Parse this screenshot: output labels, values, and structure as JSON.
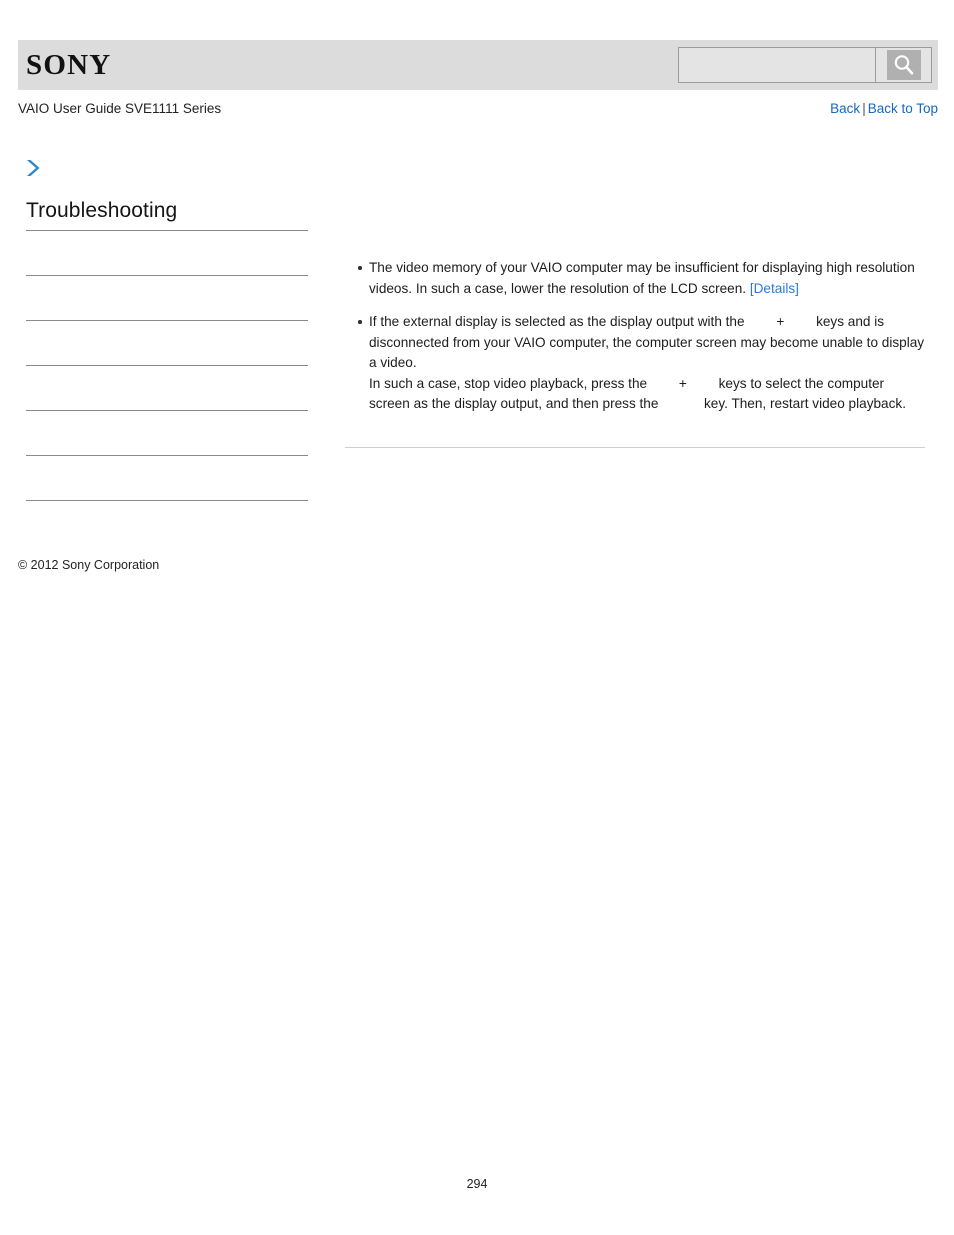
{
  "header": {
    "logo_text": "SONY",
    "search": {
      "value": "",
      "placeholder": "",
      "icon": "search-icon"
    }
  },
  "subheader": {
    "guide_title": "VAIO User Guide SVE1111 Series",
    "back_label": "Back",
    "separator": "|",
    "back_to_top_label": "Back to Top"
  },
  "sidebar": {
    "expand_icon": "chevron-right-icon",
    "title": "Troubleshooting",
    "items": [
      {
        "label": ""
      },
      {
        "label": ""
      },
      {
        "label": ""
      },
      {
        "label": ""
      },
      {
        "label": ""
      },
      {
        "label": ""
      }
    ]
  },
  "content": {
    "bullets": [
      {
        "text_before_link": "The video memory of your VAIO computer may be insufficient for displaying high resolution videos. In such a case, lower the resolution of the LCD screen. ",
        "link_label": "[Details]"
      },
      {
        "line1_a": "If the external display is selected as the display output with the ",
        "line1_plus": "+",
        "line1_b": " keys and is disconnected from your VAIO computer, the computer screen may become unable to display a video.",
        "line2_a": "In such a case, stop video playback, press the ",
        "line2_plus": "+",
        "line2_b": " keys to select the computer screen as the display output, and then press the ",
        "line2_c": " key. Then, restart video playback."
      }
    ]
  },
  "footer": {
    "copyright": "© 2012 Sony Corporation",
    "page_number": "294"
  },
  "colors": {
    "header_bg": "#dcdcdc",
    "link_blue": "#1668c1",
    "detail_blue": "#2a7bd4",
    "chevron_blue": "#2f86c8"
  }
}
